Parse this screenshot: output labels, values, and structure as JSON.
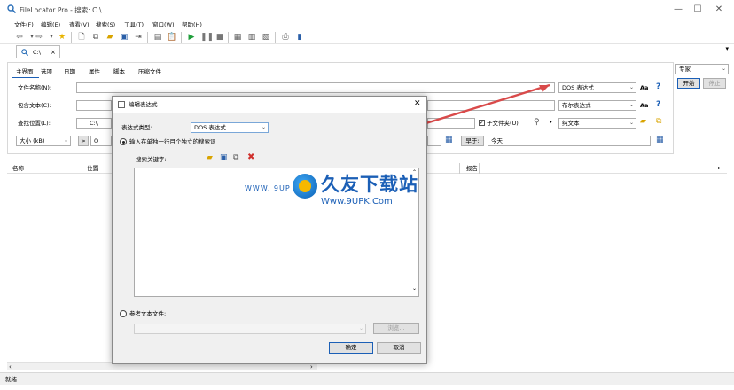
{
  "window": {
    "title": "FileLocator Pro - 搜索: C:\\",
    "minimize": "—",
    "maximize": "☐",
    "close": "✕"
  },
  "menu": [
    "文件(F)",
    "编辑(E)",
    "查看(V)",
    "搜索(S)",
    "工具(T)",
    "窗口(W)",
    "帮助(H)"
  ],
  "toolbar_icons": [
    "back-arrow-icon",
    "forward-arrow-icon",
    "favorites-star-icon",
    "new-document-icon",
    "copy-icon",
    "open-folder-icon",
    "save-icon",
    "export-icon",
    "print-preview-icon",
    "clipboard-icon",
    "play-icon",
    "pause-icon",
    "stop-icon",
    "view-icon",
    "grid-icon",
    "report-icon",
    "printer-icon",
    "book-icon"
  ],
  "doc_tab": {
    "label": "C:\\",
    "close": "×"
  },
  "criteria": {
    "tabs": [
      "主界面",
      "选项",
      "日期",
      "属性",
      "脚本",
      "压缩文件"
    ],
    "file_name_label": "文件名称(N):",
    "file_name_value": "",
    "file_name_type": "DOS 表达式",
    "contains_text_label": "包含文本(C):",
    "contains_text_type": "布尔表达式",
    "look_in_label": "查找位置(L):",
    "look_in_value": "C:\\",
    "subfolders_label": "子文件夹(U)",
    "subfolders_checked": true,
    "plain_text": "纯文本",
    "size_unit": "大小 (kB)",
    "size_op": ">",
    "size_value": "0",
    "date_op": "早于:",
    "date_value": "今天",
    "aa": "Aa",
    "help": "?"
  },
  "right_panel": {
    "mode": "专家",
    "start": "开始",
    "stop": "停止"
  },
  "results": {
    "columns": [
      "名称",
      "位置"
    ],
    "partial_col": "报告"
  },
  "status": "就绪",
  "dialog": {
    "title": "编辑表达式",
    "close": "✕",
    "expression_type_label": "表达式类型:",
    "expression_type_value": "DOS 表达式",
    "radio_single_line": "输入在单独一行目个独立的搜索词",
    "search_keywords_label": "搜索关键字:",
    "radio_reference_file": "参考文本文件:",
    "browse": "浏览...",
    "ok": "确定",
    "cancel": "取消"
  },
  "watermark": {
    "www": "WWW. 9UP",
    "cn": "久友下载站",
    "url": "Www.9UPK.Com"
  },
  "colors": {
    "accent": "#1b5fb6",
    "green_play": "#1f9e3a",
    "delete_red": "#d0312d",
    "arrow_red": "#d94a4a"
  }
}
